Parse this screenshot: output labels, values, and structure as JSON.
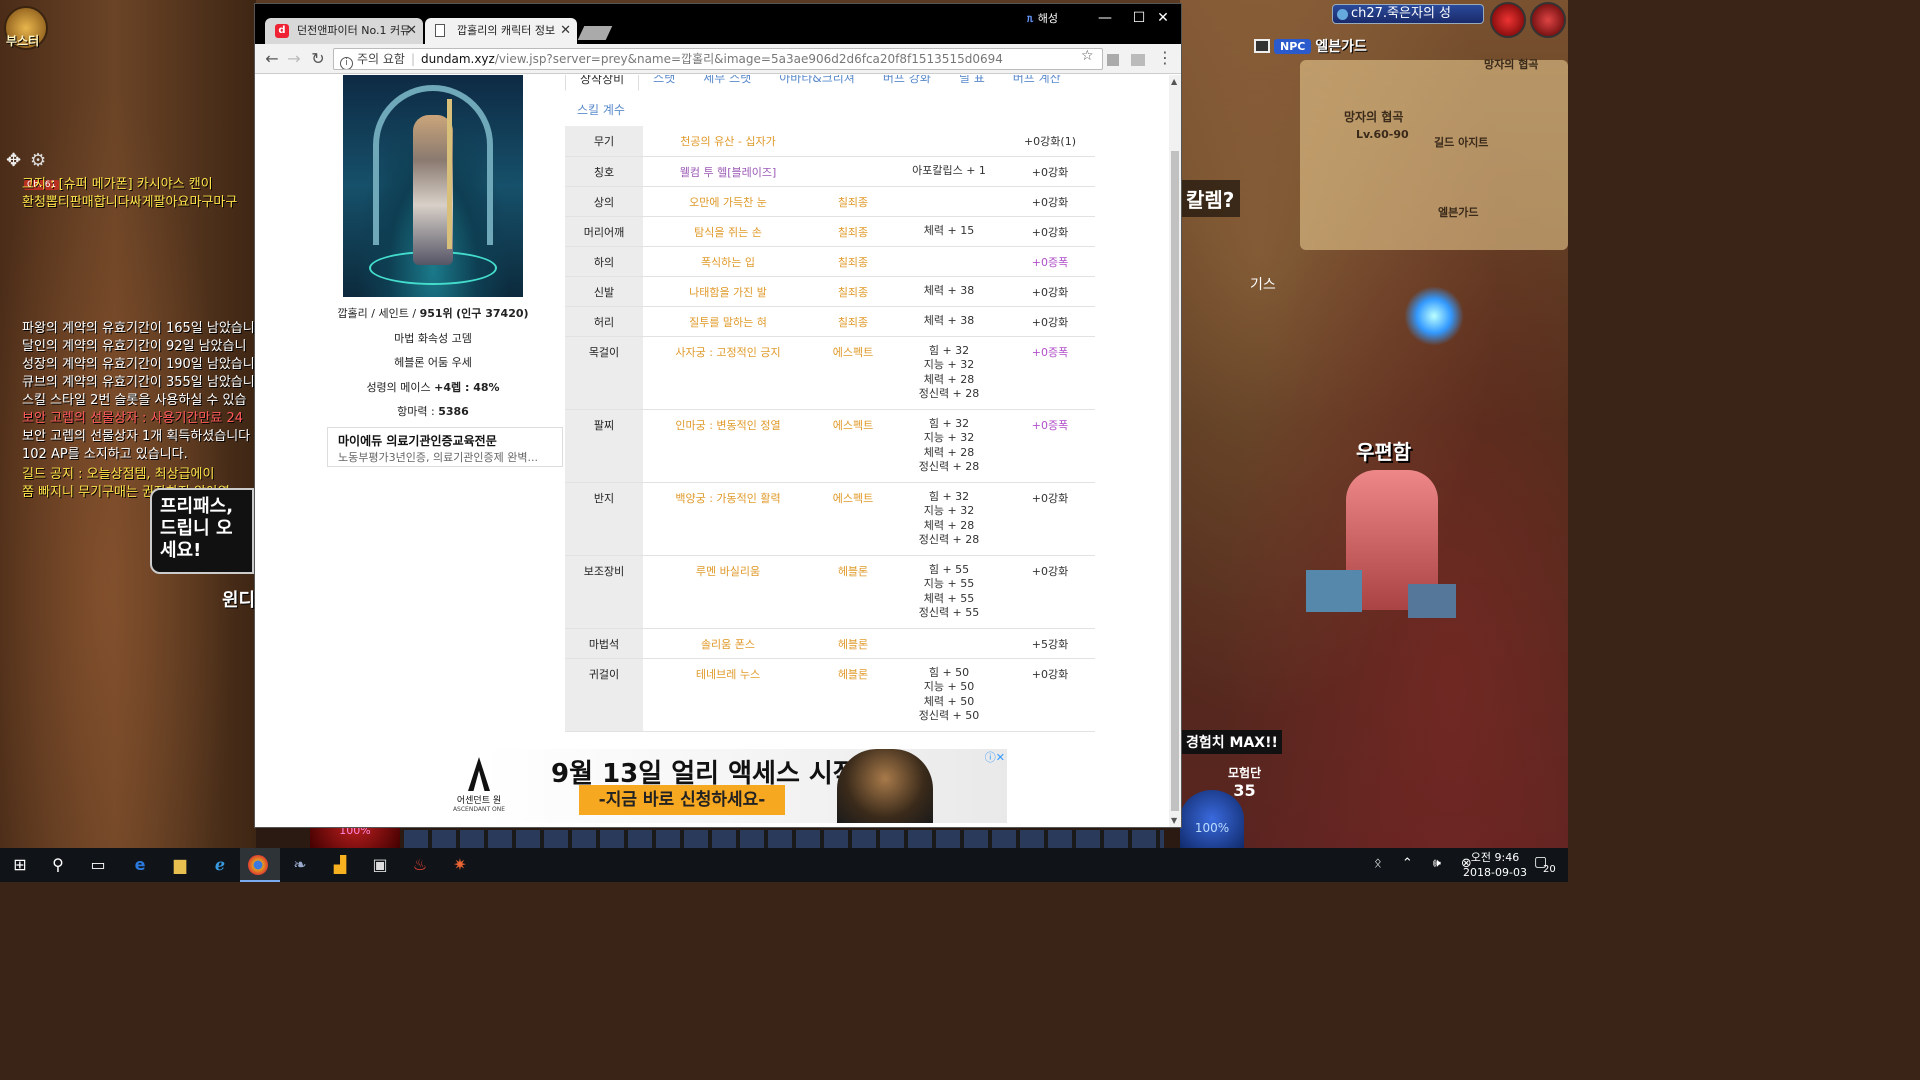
{
  "game": {
    "boost_label": "부스터",
    "channel": "ch27.죽은자의 성",
    "npc_button": "NPC",
    "area_name": "엘븐가드",
    "minimap_labels": [
      "망자의 협곡",
      "Lv.60-90",
      "길드 아지트",
      "엘븐가드",
      "망자의 협곡"
    ],
    "channel_badge": "Ch. 61",
    "chat_lines": [
      {
        "text": "그지 : [슈퍼 메가폰] 카시야스 캔이",
        "color": "yel"
      },
      {
        "text": "환청뽑티판매합니다싸게팔아요마구마구",
        "color": "yel"
      },
      {
        "text": "",
        "color": ""
      },
      {
        "text": "",
        "color": ""
      },
      {
        "text": "",
        "color": ""
      },
      {
        "text": "",
        "color": ""
      },
      {
        "text": "",
        "color": ""
      },
      {
        "text": "",
        "color": ""
      },
      {
        "text": "파왕의 계약의 유효기간이 165일 남았습니",
        "color": ""
      },
      {
        "text": "달인의 계약의 유효기간이 92일 남았습니",
        "color": ""
      },
      {
        "text": "성장의 계약의 유효기간이 190일 남았습니",
        "color": ""
      },
      {
        "text": "큐브의 계약의 유효기간이 355일 남았습니",
        "color": ""
      },
      {
        "text": "스킬 스타일 2번 슬롯을 사용하실 수 있습",
        "color": ""
      },
      {
        "text": "보안 고렙의 선물상자 : 사용기간만료 24",
        "color": "red"
      },
      {
        "text": "보안 고렙의 선물상자 1개 획득하셨습니다",
        "color": ""
      },
      {
        "text": "102 AP를 소지하고 있습니다.",
        "color": ""
      }
    ],
    "guild_notice": "길드 공지 : 오늘상점템, 최상급에이",
    "guild_notice_2": "쫌 빠지니 무기구매는 권장하지 않아영",
    "speech_bubble": "프리패스, 드립니 오세요!",
    "npc_left_name": "윈디",
    "hp_label": "100%",
    "question_npc": "칼렘?",
    "ki_label": "기스",
    "postbox_label": "우편함",
    "exp_max": "경험치 MAX!!",
    "party_label": "모험단",
    "party_number": "35",
    "mp_label": "100%"
  },
  "browser": {
    "tabs": [
      {
        "favicon": "d",
        "title": "던전앤파이터 No.1 커뮤",
        "close": "✕"
      },
      {
        "title": "깝홀리의 캐릭터 정보",
        "close": "✕"
      }
    ],
    "profile_name": "해성",
    "window_controls": {
      "minimize": "—",
      "maximize": "☐",
      "close": "✕"
    },
    "address": {
      "security_label": "주의 요함",
      "host": "dundam.xyz",
      "path": "/view.jsp?server=prey&name=깝홀리&image=5a3ae906d2d6fca20f8f1513515d0694"
    }
  },
  "character": {
    "info_line_1_prefix": "깝홀리 / 세인트 / ",
    "info_line_1_rank": "951위",
    "info_line_1_pop": "(인구 37420)",
    "aura": "마법 화속성 고뎀",
    "title_line": "헤블론 어둠 우세",
    "creature_prefix": "성령의 메이스 ",
    "creature_bold": "+4렙 : 48%",
    "resist_prefix": "항마력 : ",
    "resist_value": "5386"
  },
  "side_ad": {
    "title": "마이에듀 의료기관인증교육전문",
    "desc": "노동부평가3년인증, 의료기관인증제 완벽..."
  },
  "subnav": {
    "tabs": [
      "장착장비",
      "스탯",
      "세부 스탯",
      "아바타&크리쳐",
      "버프 강화",
      "딜 표",
      "버프 계산"
    ],
    "second_row": "스킬 계수"
  },
  "equipment": [
    {
      "slot": "무기",
      "name": "천공의 유산 - 십자가",
      "name_color": "orange",
      "set": "",
      "options": [],
      "reinforce": "+0강화(1)",
      "amp": false
    },
    {
      "slot": "칭호",
      "name": "웰컴 투 헬[블레이즈]",
      "name_color": "purple",
      "set": "",
      "options": [
        "아포칼립스 + 1"
      ],
      "reinforce": "+0강화",
      "amp": false
    },
    {
      "slot": "상의",
      "name": "오만에 가득찬 눈",
      "name_color": "orange",
      "set": "칠죄종",
      "options": [],
      "reinforce": "+0강화",
      "amp": false
    },
    {
      "slot": "머리어깨",
      "name": "탐식을 쥐는 손",
      "name_color": "orange",
      "set": "칠죄종",
      "options": [
        "체력 + 15"
      ],
      "reinforce": "+0강화",
      "amp": false
    },
    {
      "slot": "하의",
      "name": "폭식하는 입",
      "name_color": "orange",
      "set": "칠죄종",
      "options": [],
      "reinforce": "+0증폭",
      "amp": true
    },
    {
      "slot": "신발",
      "name": "나태함을 가진 발",
      "name_color": "orange",
      "set": "칠죄종",
      "options": [
        "체력 + 38"
      ],
      "reinforce": "+0강화",
      "amp": false
    },
    {
      "slot": "허리",
      "name": "질투를 말하는 혀",
      "name_color": "orange",
      "set": "칠죄종",
      "options": [
        "체력 + 38"
      ],
      "reinforce": "+0강화",
      "amp": false
    },
    {
      "slot": "목걸이",
      "name": "사자궁 : 고정적인 긍지",
      "name_color": "orange",
      "set": "에스펙트",
      "options": [
        "힘 + 32",
        "지능 + 32",
        "체력 + 28",
        "정신력 + 28"
      ],
      "reinforce": "+0증폭",
      "amp": true
    },
    {
      "slot": "팔찌",
      "name": "인마궁 : 변동적인 정열",
      "name_color": "orange",
      "set": "에스펙트",
      "options": [
        "힘 + 32",
        "지능 + 32",
        "체력 + 28",
        "정신력 + 28"
      ],
      "reinforce": "+0증폭",
      "amp": true
    },
    {
      "slot": "반지",
      "name": "백양궁 : 가동적인 활력",
      "name_color": "orange",
      "set": "에스펙트",
      "options": [
        "힘 + 32",
        "지능 + 32",
        "체력 + 28",
        "정신력 + 28"
      ],
      "reinforce": "+0강화",
      "amp": false
    },
    {
      "slot": "보조장비",
      "name": "루멘 바실리움",
      "name_color": "orange",
      "set": "헤블론",
      "options": [
        "힘 + 55",
        "지능 + 55",
        "체력 + 55",
        "정신력 + 55"
      ],
      "reinforce": "+0강화",
      "amp": false
    },
    {
      "slot": "마법석",
      "name": "솔리움 폰스",
      "name_color": "orange",
      "set": "헤블론",
      "options": [],
      "reinforce": "+5강화",
      "amp": false
    },
    {
      "slot": "귀걸이",
      "name": "테네브레 누스",
      "name_color": "orange",
      "set": "헤블론",
      "options": [
        "힘 + 50",
        "지능 + 50",
        "체력 + 50",
        "정신력 + 50"
      ],
      "reinforce": "+0강화",
      "amp": false
    }
  ],
  "banner_ad": {
    "logo_text": "어센던트 원",
    "logo_sub": "ASCENDANT ONE",
    "title": "9월 13일 얼리 액세스 시작!",
    "cta": "-지금 바로 신청하세요-",
    "ad_icons": "ⓘ✕"
  },
  "taskbar": {
    "clock_time": "오전 9:46",
    "clock_date": "2018-09-03",
    "notification_count": "20",
    "tray_icons": "ᛟ ⌃ 🕪 ⊗"
  }
}
